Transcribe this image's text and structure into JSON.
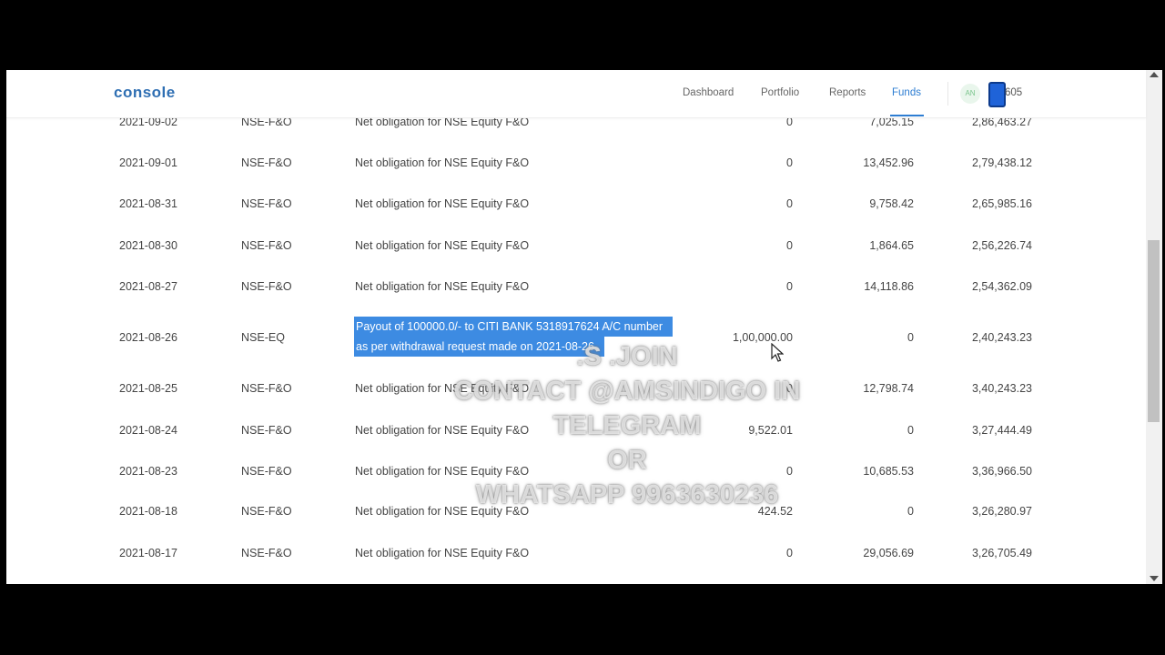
{
  "header": {
    "logo": "console",
    "nav": [
      "Dashboard",
      "Portfolio",
      "Reports",
      "Funds"
    ],
    "active_nav": "Funds",
    "avatar_initials": "AN",
    "user_id": "605"
  },
  "ledger": {
    "rows": [
      {
        "date": "2021-09-02",
        "segment": "NSE-F&O",
        "particulars": "Net obligation for NSE Equity F&O",
        "debit": "0",
        "credit": "7,025.15",
        "balance": "2,86,463.27"
      },
      {
        "date": "2021-09-01",
        "segment": "NSE-F&O",
        "particulars": "Net obligation for NSE Equity F&O",
        "debit": "0",
        "credit": "13,452.96",
        "balance": "2,79,438.12"
      },
      {
        "date": "2021-08-31",
        "segment": "NSE-F&O",
        "particulars": "Net obligation for NSE Equity F&O",
        "debit": "0",
        "credit": "9,758.42",
        "balance": "2,65,985.16"
      },
      {
        "date": "2021-08-30",
        "segment": "NSE-F&O",
        "particulars": "Net obligation for NSE Equity F&O",
        "debit": "0",
        "credit": "1,864.65",
        "balance": "2,56,226.74"
      },
      {
        "date": "2021-08-27",
        "segment": "NSE-F&O",
        "particulars": "Net obligation for NSE Equity F&O",
        "debit": "0",
        "credit": "14,118.86",
        "balance": "2,54,362.09"
      },
      {
        "date": "2021-08-26",
        "segment": "NSE-EQ",
        "particulars_line1": "Payout of 100000.0/- to CITI BANK 5318917624 A/C number",
        "particulars_line2": "as per withdrawal request made on 2021-08-26",
        "debit": "1,00,000.00",
        "credit": "0",
        "balance": "2,40,243.23"
      },
      {
        "date": "2021-08-25",
        "segment": "NSE-F&O",
        "particulars": "Net obligation for NSE Equity F&O",
        "debit": "0",
        "credit": "12,798.74",
        "balance": "3,40,243.23"
      },
      {
        "date": "2021-08-24",
        "segment": "NSE-F&O",
        "particulars": "Net obligation for NSE Equity F&O",
        "debit": "9,522.01",
        "credit": "0",
        "balance": "3,27,444.49"
      },
      {
        "date": "2021-08-23",
        "segment": "NSE-F&O",
        "particulars": "Net obligation for NSE Equity F&O",
        "debit": "0",
        "credit": "10,685.53",
        "balance": "3,36,966.50"
      },
      {
        "date": "2021-08-18",
        "segment": "NSE-F&O",
        "particulars": "Net obligation for NSE Equity F&O",
        "debit": "424.52",
        "credit": "0",
        "balance": "3,26,280.97"
      },
      {
        "date": "2021-08-17",
        "segment": "NSE-F&O",
        "particulars": "Net obligation for NSE Equity F&O",
        "debit": "0",
        "credit": "29,056.69",
        "balance": "3,26,705.49"
      }
    ]
  },
  "watermark": {
    "lines": [
      ".S .JOIN",
      "CONTACT @AMSINDIGO IN",
      "TELEGRAM",
      "OR",
      "WHATSAPP 9963630236"
    ]
  },
  "colors": {
    "brand": "#2f6fb3",
    "active_nav": "#2d7dd2",
    "selection": "#3d8be2"
  },
  "icons": [
    "phone-icon",
    "cursor-icon"
  ]
}
